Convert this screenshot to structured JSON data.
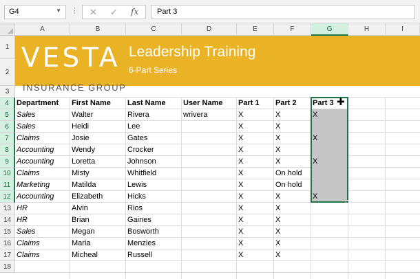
{
  "formula_bar": {
    "name_box": "G4",
    "cancel_symbol": "✕",
    "enter_symbol": "✓",
    "fx_symbol": "fx",
    "formula_value": "Part 3"
  },
  "columns": [
    "A",
    "B",
    "C",
    "D",
    "E",
    "F",
    "G",
    "H",
    "I"
  ],
  "rows": [
    "1",
    "2",
    "3",
    "4",
    "5",
    "6",
    "7",
    "8",
    "9",
    "10",
    "11",
    "12",
    "13",
    "14",
    "15",
    "16",
    "17",
    "18"
  ],
  "banner": {
    "logo": "VESTA",
    "title": "Leadership Training",
    "subtitle": "6-Part Series",
    "color": "#e9b325"
  },
  "company_line": "INSURANCE   GROUP",
  "table": {
    "headers": [
      "Department",
      "First Name",
      "Last Name",
      "User Name",
      "Part 1",
      "Part 2",
      "Part 3"
    ],
    "rows": [
      [
        "Sales",
        "Walter",
        "Rivera",
        "wrivera",
        "X",
        "X",
        "X"
      ],
      [
        "Sales",
        "Heidi",
        "Lee",
        "",
        "X",
        "X",
        ""
      ],
      [
        "Claims",
        "Josie",
        "Gates",
        "",
        "X",
        "X",
        "X"
      ],
      [
        "Accounting",
        "Wendy",
        "Crocker",
        "",
        "X",
        "X",
        ""
      ],
      [
        "Accounting",
        "Loretta",
        "Johnson",
        "",
        "X",
        "X",
        "X"
      ],
      [
        "Claims",
        "Misty",
        "Whitfield",
        "",
        "X",
        "On hold",
        ""
      ],
      [
        "Marketing",
        "Matilda",
        "Lewis",
        "",
        "X",
        "On hold",
        ""
      ],
      [
        "Accounting",
        "Elizabeth",
        "Hicks",
        "",
        "X",
        "X",
        "X"
      ],
      [
        "HR",
        "Alvin",
        "Rios",
        "",
        "X",
        "X",
        ""
      ],
      [
        "HR",
        "Brian",
        "Gaines",
        "",
        "X",
        "X",
        ""
      ],
      [
        "Sales",
        "Megan",
        "Bosworth",
        "",
        "X",
        "X",
        ""
      ],
      [
        "Claims",
        "Maria",
        "Menzies",
        "",
        "X",
        "X",
        ""
      ],
      [
        "Claims",
        "Micheal",
        "Russell",
        "",
        "X",
        "X",
        ""
      ]
    ]
  },
  "selection": {
    "active_cell": "G4",
    "range": "G4:G12",
    "accent": "#217346"
  }
}
